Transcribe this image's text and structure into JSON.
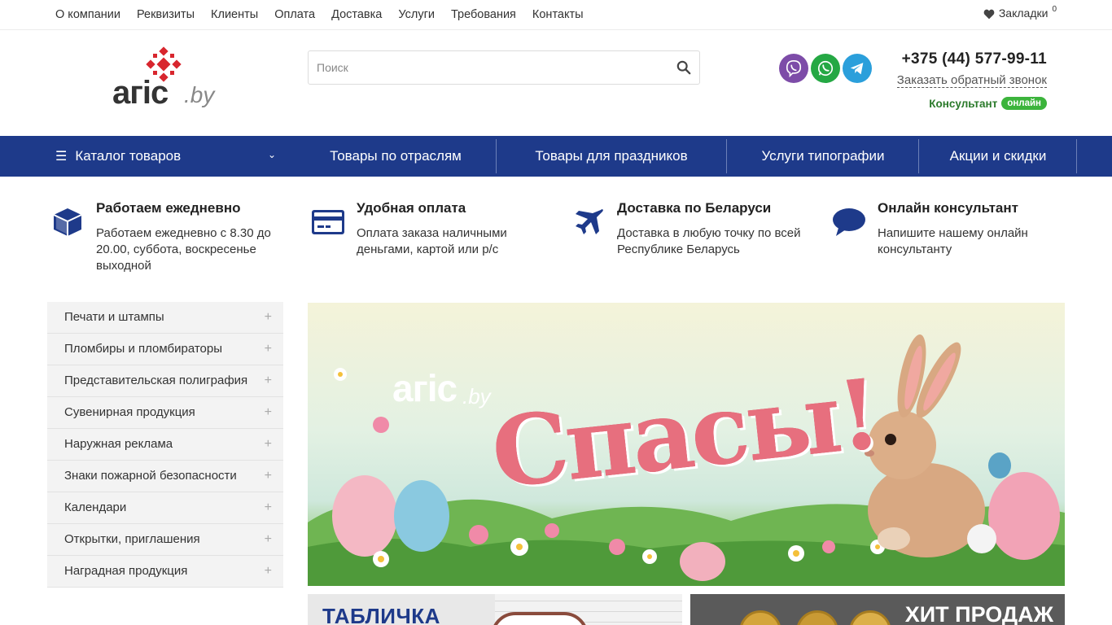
{
  "topnav": {
    "items": [
      "О компании",
      "Реквизиты",
      "Клиенты",
      "Оплата",
      "Доставка",
      "Услуги",
      "Требования",
      "Контакты"
    ],
    "bookmarks_label": "Закладки",
    "bookmarks_count": "0"
  },
  "header": {
    "logo_main": "агіс",
    "logo_sub": ".by",
    "search_placeholder": "Поиск",
    "phone": "+375 (44) 577-99-11",
    "callback": "Заказать обратный звонок",
    "consultant_label": "Консультант",
    "consultant_status": "онлайн",
    "messengers": [
      "viber-icon",
      "whatsapp-icon",
      "telegram-icon"
    ]
  },
  "mainnav": {
    "catalog": "Каталог товаров",
    "items": [
      "Товары по отраслям",
      "Товары для праздников",
      "Услуги типографии",
      "Акции и скидки"
    ]
  },
  "features": [
    {
      "icon": "box-icon",
      "title": "Работаем ежедневно",
      "text": "Работаем ежедневно с 8.30 до 20.00, суббота, воскресенье выходной"
    },
    {
      "icon": "card-icon",
      "title": "Удобная оплата",
      "text": "Оплата заказа наличными деньгами, картой или р/с"
    },
    {
      "icon": "plane-icon",
      "title": "Доставка по Беларуси",
      "text": "Доставка в любую точку по всей Республике Беларусь"
    },
    {
      "icon": "chat-icon",
      "title": "Онлайн консультант",
      "text": "Напишите нашему онлайн консультанту"
    }
  ],
  "sidebar": {
    "items": [
      "Печати и штампы",
      "Пломбиры и пломбираторы",
      "Представительская полиграфия",
      "Сувенирная продукция",
      "Наружная реклама",
      "Знаки пожарной безопасности",
      "Календари",
      "Открытки, приглашения",
      "Наградная продукция"
    ]
  },
  "banner": {
    "logo_main": "агіс",
    "logo_sub": ".by",
    "headline": "Спасы!"
  },
  "promos": [
    {
      "title": "ТАБЛИЧКА"
    },
    {
      "title": "ХИТ ПРОДАЖ"
    }
  ],
  "colors": {
    "nav_bg": "#1e3a8a",
    "accent_green": "#3cb43c",
    "icon_blue": "#1e3a8a"
  }
}
